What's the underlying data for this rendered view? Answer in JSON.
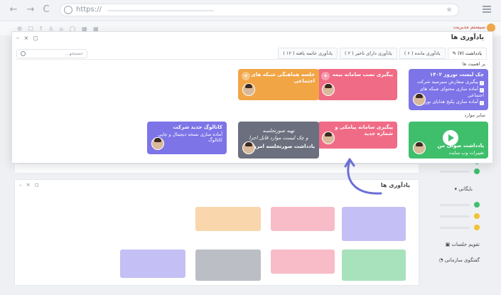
{
  "browser": {
    "url_text": "https://",
    "back_icon": "←",
    "forward_icon": "→",
    "reload_icon": "C",
    "star_icon": "★"
  },
  "app_strip": {
    "brand": "سیستم مدیریت"
  },
  "window": {
    "title": "یادآوری ها",
    "controls": "– × ◻",
    "search_placeholder": "جستجو...",
    "tabs": [
      {
        "label": "یادداشت (۷)",
        "active": true
      },
      {
        "label": "یادآوری مانده ( ۶ )",
        "chip": "۶",
        "chip_color": "#f0b429"
      },
      {
        "label": "یادآوری دارای تاخیر ( ۲ )",
        "chip": "۲",
        "chip_color": "#e84b6e"
      },
      {
        "label": "یادآوری خاتمه یافته ( ۱۲ )",
        "chip": "۱۲",
        "chip_color": "#9bbf5f"
      }
    ],
    "section_priority": "پر اهمیت ها",
    "section_other": "سایر موارد"
  },
  "cards": {
    "purple": {
      "title": "چک لیست نوروز ۱۴۰۲",
      "items": [
        "پیگیری سفارش سیرسید شرکت",
        "آماده سازی محتوای شبکه های اجتماعی",
        "آماده سازی پکیج هدایای نوروز"
      ],
      "color": "#7d74e8"
    },
    "pink": {
      "title": "پیگیری نصب سامانه بیمه",
      "color": "#f06b86"
    },
    "orange": {
      "title": "جلسه هماهنگی شبکه های اجتماعی",
      "color": "#f1a545"
    },
    "green": {
      "title": "یادداشت صوتی من",
      "sub": "تغییرات وب سایت",
      "color": "#3fbf6b"
    },
    "pink2": {
      "title": "پیگیری سامانه پیامکی و شماره جدید",
      "color": "#f06b86"
    },
    "gray": {
      "hand1": "تهیه صورتجلسه",
      "hand2": "و چک لیست موارد قابل اجرا",
      "title": "یادداشت صورتجلسه امروز",
      "color": "#6b6f7e"
    },
    "violet": {
      "title": "کاتالوگ جدید شرکت",
      "sub": "آماده سازی نسخه دیجیتال و چاپی کاتالوگ",
      "color": "#7d74e8"
    }
  },
  "sidebar": {
    "group_label": "بایگانی",
    "calendar_label": "تقویم جلسات",
    "chat_label": "گفتگوی سازمانی",
    "dots": [
      "#3fbf6b",
      "#3fbf6b",
      "#f06b86",
      "#f1c232",
      "#3fbf6b"
    ]
  },
  "ghost": {
    "title": "یادآوری ها",
    "controls": "– × ◻"
  }
}
